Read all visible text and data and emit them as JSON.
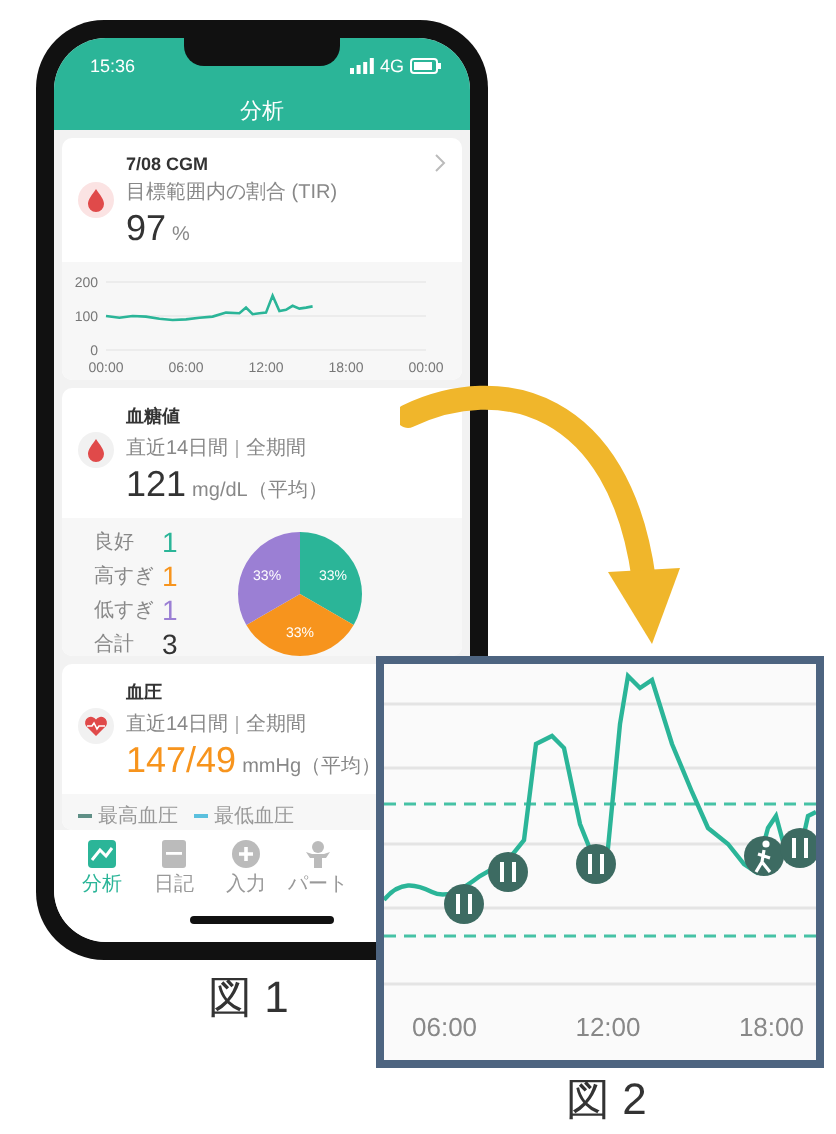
{
  "phone": {
    "status_bar": {
      "time": "15:36",
      "network": "4G"
    },
    "title": "分析",
    "cgm_card": {
      "title": "7/08 CGM",
      "subtitle": "目標範囲内の割合 (TIR)",
      "value": "97",
      "unit": "%",
      "chart_data": {
        "type": "line",
        "x": [
          0,
          1,
          2,
          3,
          4,
          5,
          6,
          7,
          8,
          9,
          10,
          10.5,
          11,
          11.5,
          12,
          12.5,
          13,
          13.5,
          14,
          14.5,
          15,
          15.5
        ],
        "series": [
          {
            "color": "#2bb598",
            "values": [
              100,
              95,
              100,
              98,
              92,
              88,
              90,
              95,
              98,
              110,
              108,
              125,
              105,
              108,
              110,
              160,
              115,
              118,
              130,
              122,
              125,
              128
            ]
          }
        ],
        "xlim": [
          0,
          24
        ],
        "ylim": [
          0,
          200
        ],
        "yticks": [
          0,
          100,
          200
        ],
        "xticks": [
          {
            "value": 0,
            "label": "00:00"
          },
          {
            "value": 6,
            "label": "06:00"
          },
          {
            "value": 12,
            "label": "12:00"
          },
          {
            "value": 18,
            "label": "18:00"
          },
          {
            "value": 24,
            "label": "00:00"
          }
        ]
      }
    },
    "glucose_card": {
      "title": "血糖値",
      "period": "直近14日間",
      "range": "全期間",
      "value": "121",
      "unit": "mg/dL（平均）",
      "stats": [
        {
          "label": "良好",
          "value": "1",
          "color": "#2bb598"
        },
        {
          "label": "高すぎ",
          "value": "1",
          "color": "#f7941d"
        },
        {
          "label": "低すぎ",
          "value": "1",
          "color": "#9b7fd4"
        },
        {
          "label": "合計",
          "value": "3",
          "color": "#333333"
        }
      ],
      "chart_data": {
        "type": "pie",
        "values": [
          33.33,
          33.33,
          33.34
        ],
        "value_labels": [
          "33%",
          "33%",
          "33%"
        ]
      }
    },
    "bp_card": {
      "title": "血圧",
      "period": "直近14日間",
      "range": "全期間",
      "value": "147/49",
      "unit": "mmHg（平均）",
      "legend": [
        {
          "label": "最高血圧",
          "color": "#5f8f86"
        },
        {
          "label": "最低血圧",
          "color": "#5bc0de"
        }
      ]
    },
    "tabs": [
      {
        "label": "分析",
        "kind": "chart",
        "selected": true
      },
      {
        "label": "日記",
        "kind": "notebook",
        "selected": false
      },
      {
        "label": "入力",
        "kind": "plus",
        "selected": false
      },
      {
        "label": "パート",
        "kind": "person",
        "selected": false
      }
    ]
  },
  "figure1_caption": "図 1",
  "zoom_inset": {
    "x_labels": [
      "06:00",
      "12:00",
      "18:00"
    ]
  },
  "figure2_caption": "図 2"
}
